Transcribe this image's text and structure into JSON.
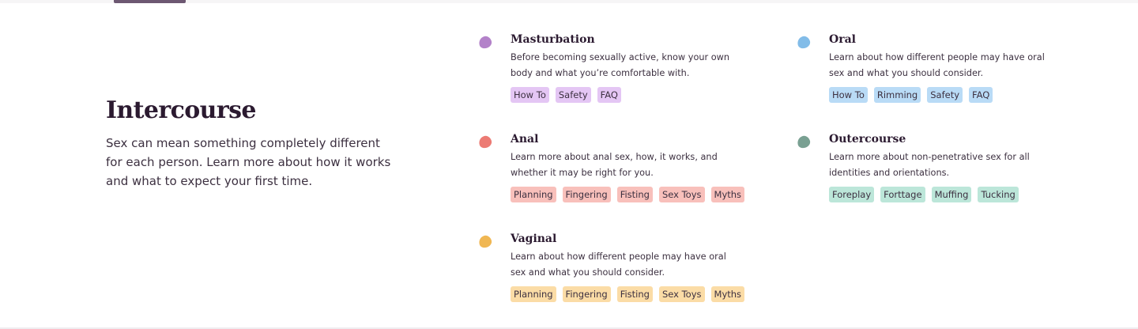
{
  "section": {
    "title": "Intercourse",
    "description": "Sex can mean something completely different for each person. Learn more about how it works and what to expect your first time."
  },
  "colors": {
    "purple_dot": "#b382c9",
    "purple_tag": "#e4c6f4",
    "blue_dot": "#82bce8",
    "blue_tag": "#b9dbf6",
    "red_dot": "#ec7b74",
    "red_tag": "#f8c0bb",
    "green_dot": "#79a092",
    "green_tag": "#bce6d9",
    "yellow_dot": "#f0b753",
    "yellow_tag": "#fbdca6",
    "tab_indicator": "#6d5872"
  },
  "topics": [
    {
      "title": "Masturbation",
      "description": "Before becoming sexually active, know your own body and what you’re comfortable with.",
      "tags": [
        "How To",
        "Safety",
        "FAQ"
      ]
    },
    {
      "title": "Oral",
      "description": "Learn about how different people may have oral sex and what you should consider.",
      "tags": [
        "How To",
        "Rimming",
        "Safety",
        "FAQ"
      ]
    },
    {
      "title": "Anal",
      "description": "Learn more about anal sex, how, it works, and whether it may be right for you.",
      "tags": [
        "Planning",
        "Fingering",
        "Fisting",
        "Sex Toys",
        "Myths"
      ]
    },
    {
      "title": "Outercourse",
      "description": "Learn more about non-penetrative sex for all identities and orientations.",
      "tags": [
        "Foreplay",
        "Forttage",
        "Muffing",
        "Tucking"
      ]
    },
    {
      "title": "Vaginal",
      "description": "Learn about how different people may have oral sex and what you should consider.",
      "tags": [
        "Planning",
        "Fingering",
        "Fisting",
        "Sex Toys",
        "Myths"
      ]
    }
  ]
}
